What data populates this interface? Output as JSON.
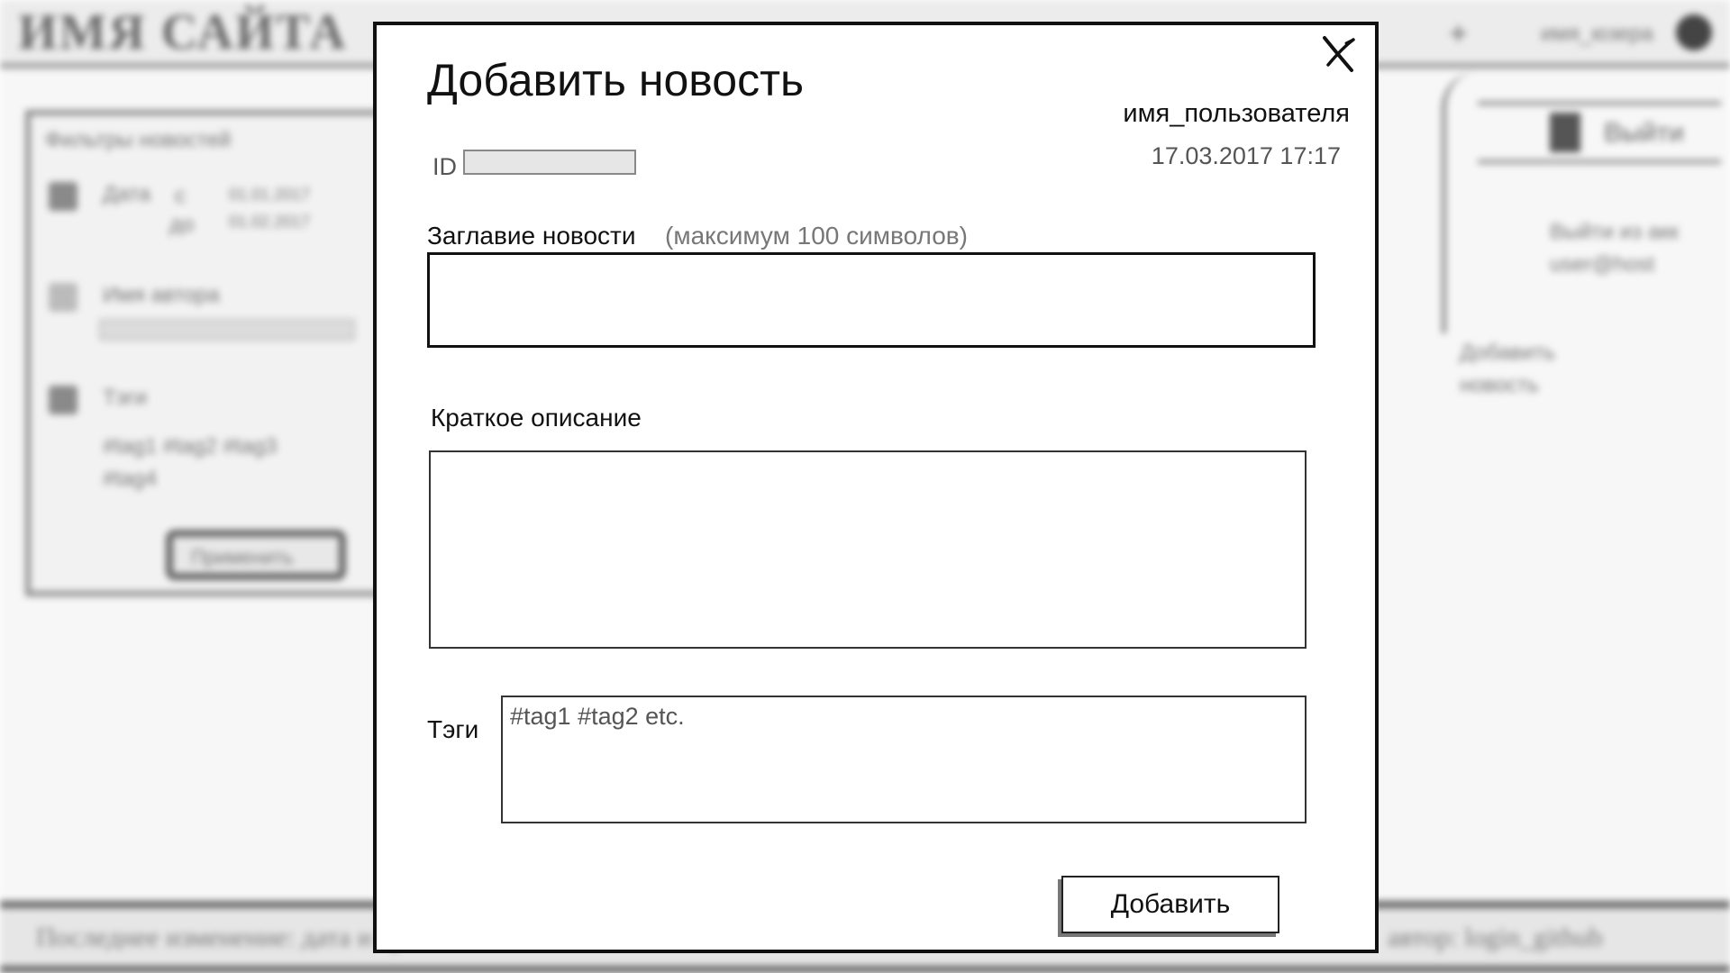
{
  "background": {
    "site_name": "ИМЯ САЙТА",
    "user_name": "имя_юзера",
    "plus_glyph": "+",
    "logout_label": "Выйти",
    "note_logout": [
      "Выйти из акк",
      "user@host"
    ],
    "note_add": [
      "Добавить",
      "новость"
    ],
    "filter_panel": {
      "title": "Фильтры новостей",
      "date_label": "Дата",
      "date_from_prefix": "с",
      "date_to_prefix": "до",
      "date_from_value": "01.01.2017",
      "date_to_value": "01.02.2017",
      "author_label": "Имя автора",
      "tags_label": "Тэги",
      "tags_value": "#tag1 #tag2 #tag3 #tag4",
      "apply_label": "Применить"
    },
    "footer_left": "Последнее изменение: дата и время",
    "footer_right": "автор: login_github"
  },
  "modal": {
    "title": "Добавить новость",
    "username": "имя_пользователя",
    "datetime": "17.03.2017 17:17",
    "id_label": "ID",
    "id_value": "",
    "title_label": "Заглавие новости",
    "title_hint": "(максимум 100 символов)",
    "title_value": "",
    "desc_label": "Краткое описание",
    "desc_value": "",
    "tags_label": "Тэги",
    "tags_placeholder": "#tag1 #tag2 etc.",
    "add_button_label": "Добавить",
    "close_icon": "close-icon"
  }
}
